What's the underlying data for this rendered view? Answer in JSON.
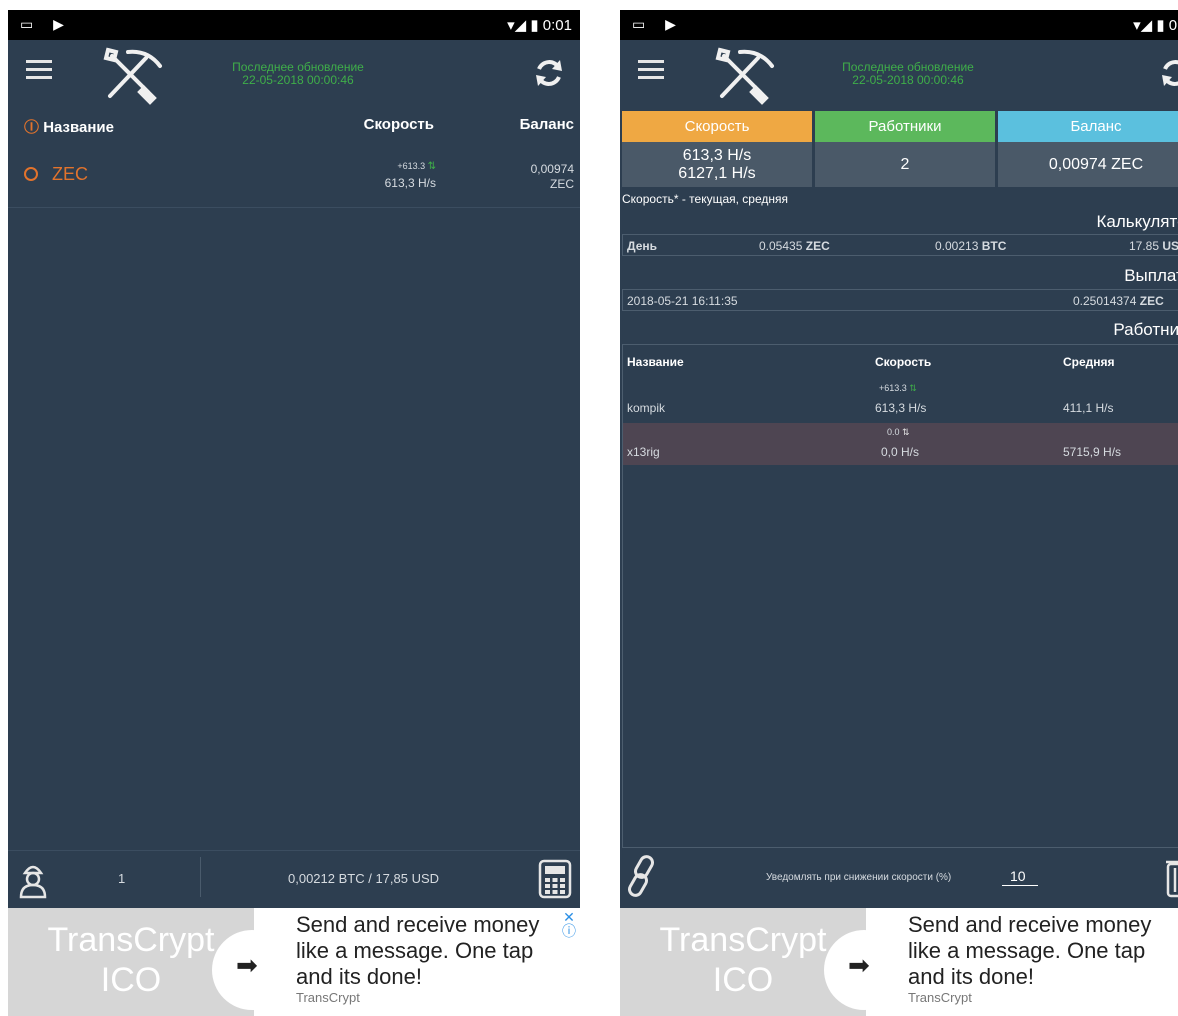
{
  "status_bar": {
    "time": "0:01"
  },
  "left": {
    "last_update_label": "Последнее обновление",
    "last_update_time": "22-05-2018 00:00:46",
    "columns": {
      "name": "Название",
      "speed": "Скорость",
      "balance": "Баланс"
    },
    "coin": {
      "name": "ZEC",
      "speed_change": "+613.3",
      "speed": "613,3 H/s",
      "balance_value": "0,00974",
      "balance_unit": "ZEC"
    },
    "footer": {
      "workers_count": "1",
      "totals": "0,00212 BTC / 17,85 USD"
    }
  },
  "right": {
    "last_update_label": "Последнее обновление",
    "last_update_time": "22-05-2018 00:00:46",
    "stats": [
      {
        "label": "Скорость",
        "color": "#efa843",
        "lines": [
          "613,3 H/s",
          "6127,1 H/s"
        ]
      },
      {
        "label": "Работники",
        "color": "#5cb85c",
        "lines": [
          "2"
        ]
      },
      {
        "label": "Баланс",
        "color": "#5bc0de",
        "lines": [
          "0,00974 ZEC"
        ]
      }
    ],
    "speed_legend": "Скорость* - текущая, средняя",
    "calculator_title": "Калькулятор",
    "calculator": {
      "period": "День",
      "zec_value": "0.05435",
      "zec_unit": "ZEC",
      "btc_value": "0.00213",
      "btc_unit": "BTC",
      "usd_value": "17.85",
      "usd_unit": "USD"
    },
    "payouts_title": "Выплаты",
    "payout": {
      "date": "2018-05-21 16:11:35",
      "amount": "0.25014374",
      "unit": "ZEC"
    },
    "workers_title": "Работники",
    "workers_columns": {
      "name": "Название",
      "speed": "Скорость",
      "avg": "Средняя"
    },
    "workers": [
      {
        "name": "kompik",
        "change": "+613.3",
        "speed": "613,3 H/s",
        "avg": "411,1 H/s",
        "highlight": false
      },
      {
        "name": "x13rig",
        "change": "0.0",
        "speed": "0,0 H/s",
        "avg": "5715,9 H/s",
        "highlight": true
      }
    ],
    "notify_label": "Уведомлять при снижении скорости (%)",
    "notify_value": "10"
  },
  "ad": {
    "brand_line1": "TransCrypt",
    "brand_line2": "ICO",
    "text": "Send and receive money like a message. One tap and its done!",
    "source": "TransCrypt"
  },
  "colors": {
    "background": "#2d3e50",
    "accent_orange": "#e2732c",
    "update_green": "#3fae49"
  }
}
